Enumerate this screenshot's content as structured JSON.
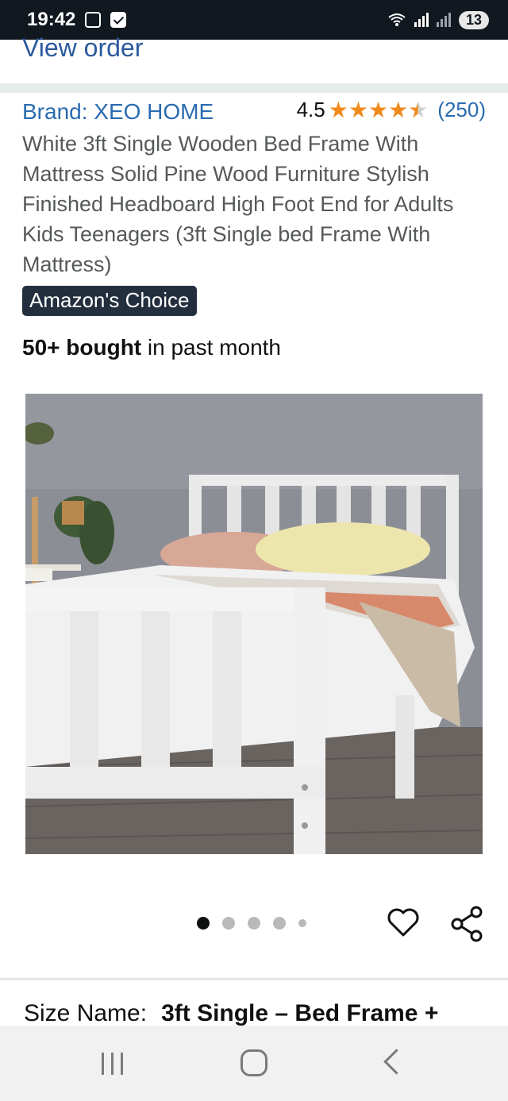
{
  "status_bar": {
    "time": "19:42",
    "battery": "13",
    "icons": [
      "screenshot-icon",
      "check-icon",
      "wifi-icon",
      "signal-icon",
      "signal-icon"
    ]
  },
  "view_order": "View order",
  "product": {
    "brand": "Brand: XEO HOME",
    "rating": "4.5",
    "rating_value": 4.5,
    "review_count": "(250)",
    "title": "White 3ft Single Wooden Bed Frame With Mattress Solid Pine Wood Furniture Stylish Finished Headboard High Foot End for Adults Kids Teenagers (3ft Single bed Frame With Mattress)",
    "badge": "Amazon's Choice",
    "bought_bold": "50+ bought",
    "bought_rest": " in past month"
  },
  "carousel": {
    "total": 5,
    "active_index": 0
  },
  "size": {
    "label": "Size Name:",
    "value": "3ft Single – Bed Frame +"
  },
  "colors": {
    "link": "#2a6bb0",
    "star": "#f08a1c",
    "badge_bg": "#232f3e"
  }
}
